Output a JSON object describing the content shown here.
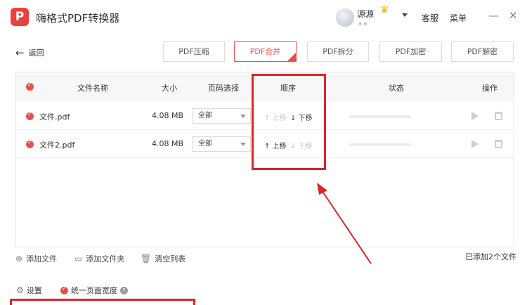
{
  "app": {
    "logo_letter": "P",
    "title": "嗨格式PDF转换器"
  },
  "user": {
    "name": "源源",
    "level": "a.a"
  },
  "header": {
    "service_label": "客服",
    "menu_label": "菜单",
    "minimize_glyph": "—",
    "close_glyph": "✕"
  },
  "nav": {
    "back_label": "返回",
    "tabs": [
      {
        "label": "PDF压缩",
        "active": false
      },
      {
        "label": "PDF合并",
        "active": true
      },
      {
        "label": "PDF拆分",
        "active": false
      },
      {
        "label": "PDF加密",
        "active": false
      },
      {
        "label": "PDF解密",
        "active": false
      }
    ]
  },
  "table": {
    "headers": {
      "name": "文件名称",
      "size": "大小",
      "pages": "页码选择",
      "order": "顺序",
      "status": "状态",
      "actions": "操作"
    },
    "rows": [
      {
        "name": "文件.pdf",
        "size": "4.08 MB",
        "pages": "全部",
        "up_label": "↑ 上移",
        "down_label": "↓ 下移",
        "up_enabled": false,
        "down_enabled": true
      },
      {
        "name": "文件2.pdf",
        "size": "4.08 MB",
        "pages": "全部",
        "up_label": "↑ 上移",
        "down_label": "↓ 下移",
        "up_enabled": true,
        "down_enabled": false
      }
    ]
  },
  "footer": {
    "add_file": "添加文件",
    "add_folder": "添加文件夹",
    "clear_list": "清空列表",
    "count_text": "已添加2个文件",
    "settings": "设置",
    "uniform_width": "统一页面宽度",
    "help_glyph": "?"
  },
  "colors": {
    "accent": "#e8504e",
    "annotation": "#d9262b"
  }
}
